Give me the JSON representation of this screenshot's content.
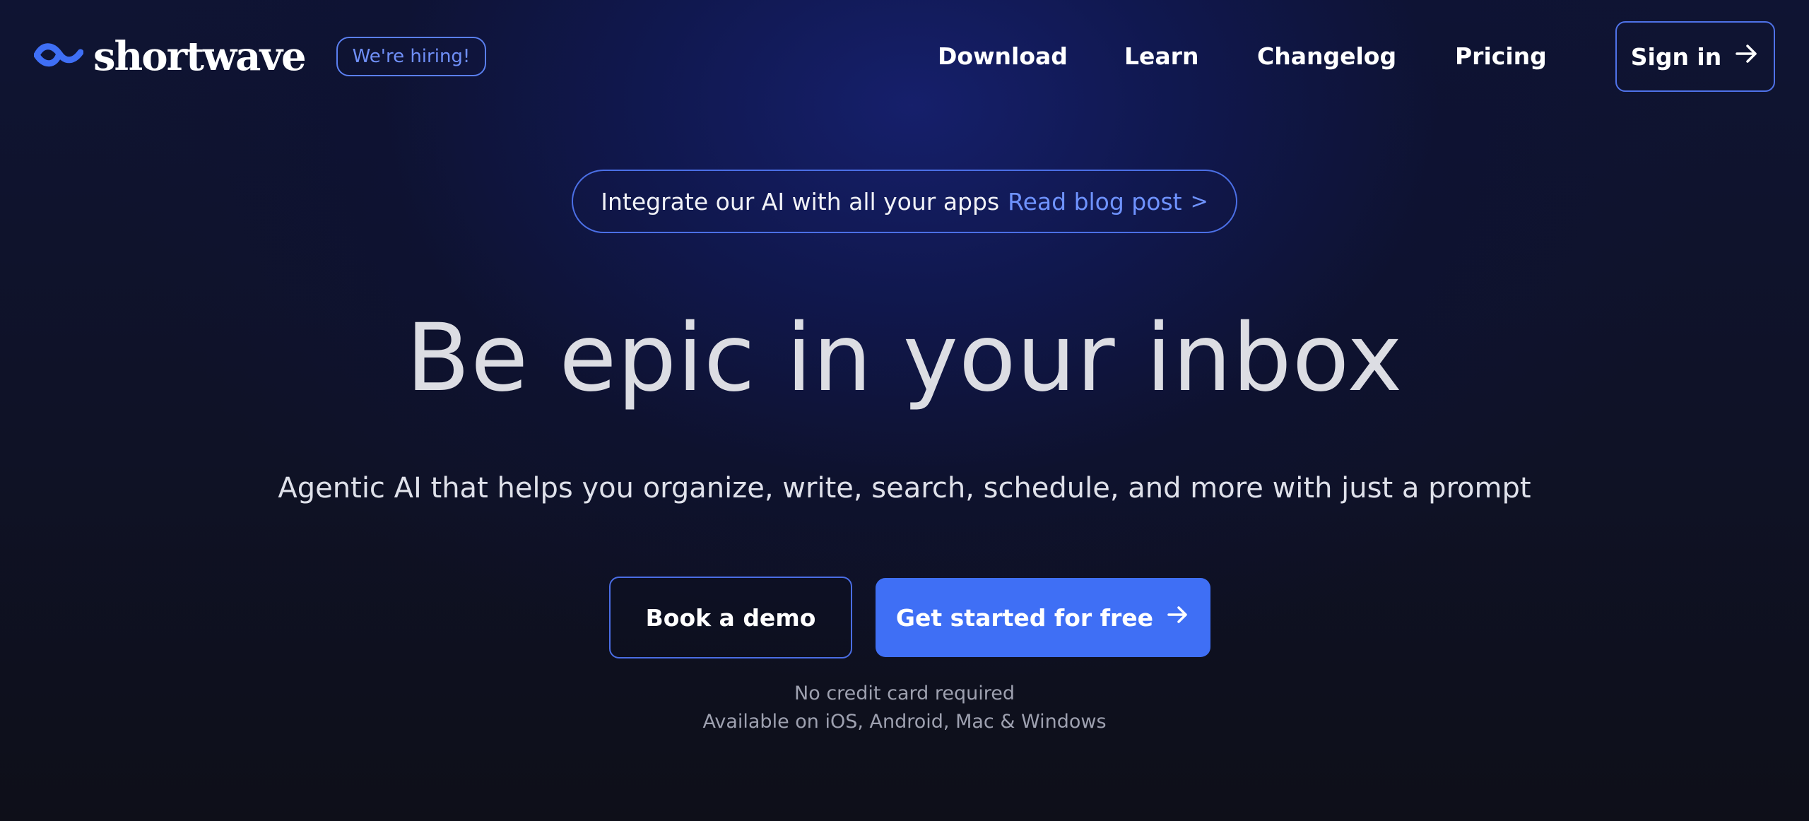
{
  "header": {
    "logo_text": "shortwave",
    "hiring_badge": "We're hiring!",
    "nav": [
      "Download",
      "Learn",
      "Changelog",
      "Pricing"
    ],
    "signin_label": "Sign in"
  },
  "announcement": {
    "text": "Integrate our AI with all your apps",
    "link": "Read blog post",
    "chevron": ">"
  },
  "hero": {
    "title": "Be epic in your inbox",
    "subtitle": "Agentic AI that helps you organize, write, search, schedule, and more with just a prompt"
  },
  "cta": {
    "demo_label": "Book a demo",
    "start_label": "Get started for free"
  },
  "notes": {
    "line1": "No credit card required",
    "line2": "Available on iOS, Android, Mac & Windows"
  },
  "icons": {
    "logo": "wave-logo-icon",
    "signin": "arrow-right-icon",
    "start": "arrow-right-icon"
  },
  "colors": {
    "accent": "#3f6ff5",
    "link": "#6f93ff",
    "border": "#4b6fe6"
  }
}
